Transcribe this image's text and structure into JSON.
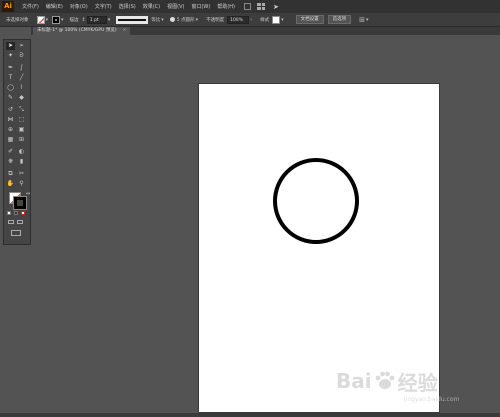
{
  "app": {
    "logo": "Ai"
  },
  "menu": [
    "文件(F)",
    "编辑(E)",
    "对象(O)",
    "文字(T)",
    "选择(S)",
    "效果(C)",
    "视图(V)",
    "窗口(W)",
    "帮助(H)"
  ],
  "control_bar": {
    "selection_label": "未选择对象",
    "stroke_label": "描边",
    "stroke_value": "1 pt",
    "stroke_style": "等比",
    "brush_value": "5 点圆形",
    "opacity_label": "不透明度",
    "opacity_value": "100%",
    "style_label": "样式",
    "doc_setup_button": "文档设置",
    "preferences_button": "首选项"
  },
  "document_tab": {
    "label": "未标题-1* @ 100% (CMYK/GPU 预览)",
    "close": "×"
  },
  "watermark": {
    "brand_a": "Bai",
    "brand_b": "经验",
    "url": "jingyan.baidu.com"
  }
}
